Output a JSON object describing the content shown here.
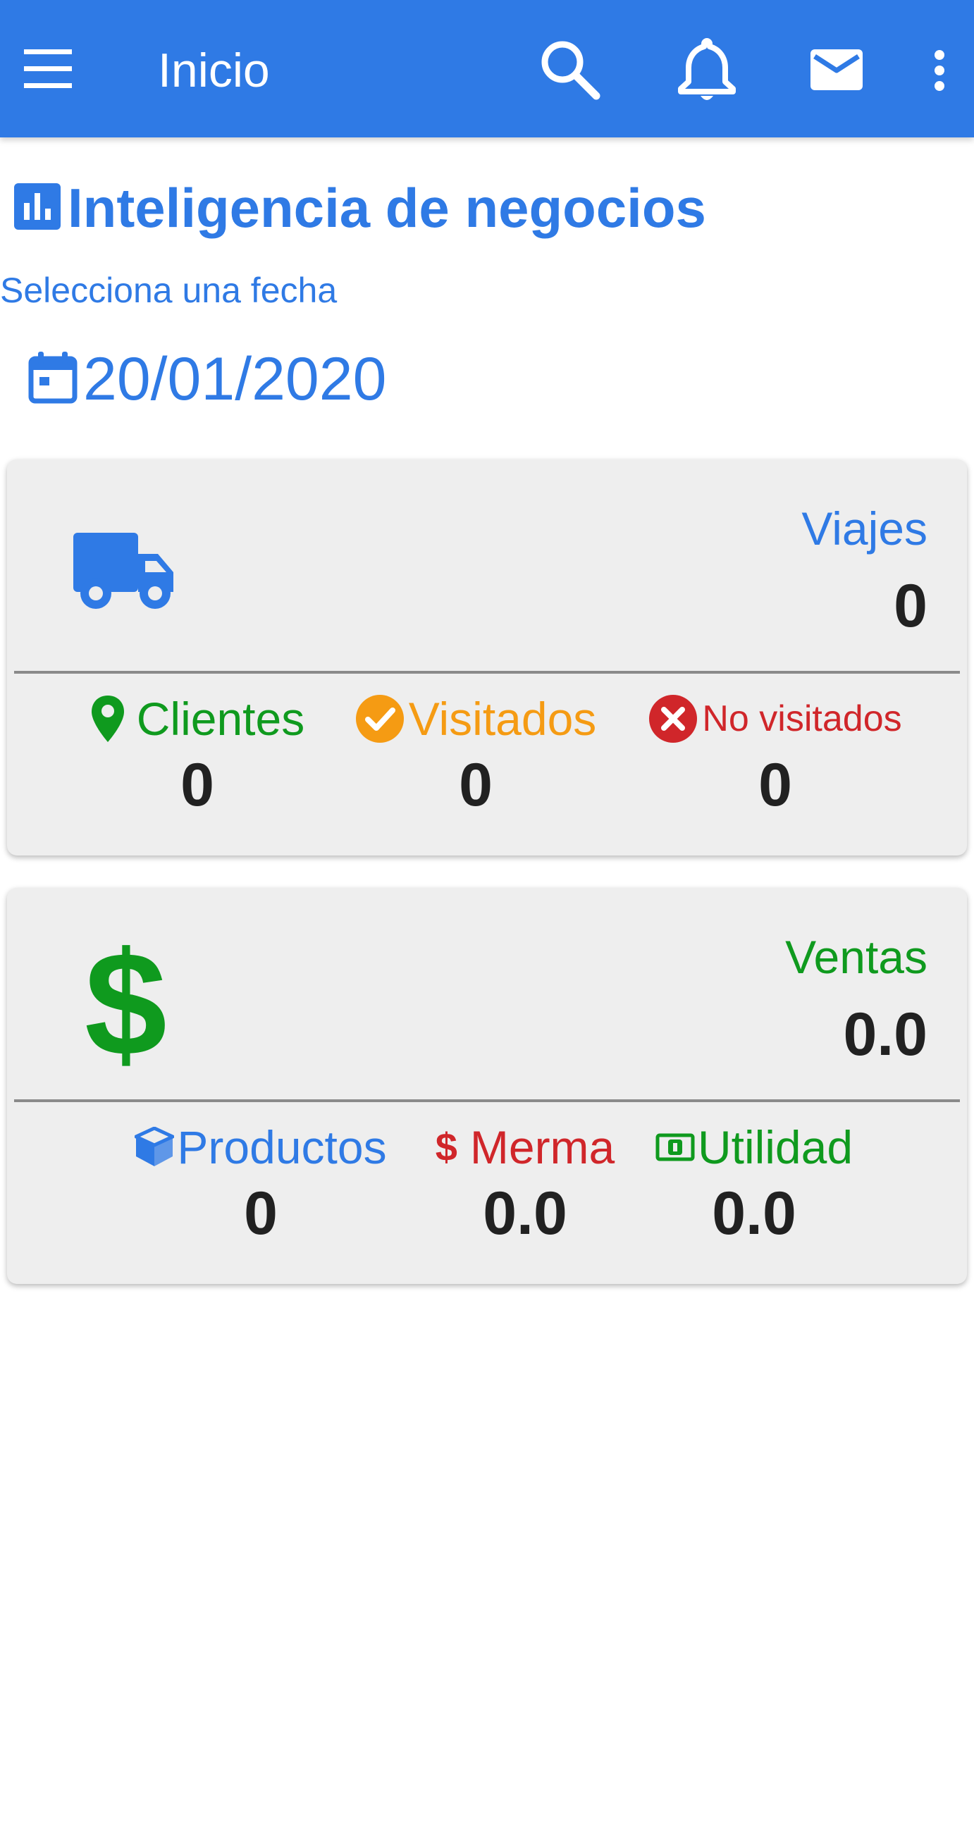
{
  "appbar": {
    "title": "Inicio",
    "icons": [
      "menu-icon",
      "search-icon",
      "bell-icon",
      "mail-icon",
      "more-vert-icon"
    ]
  },
  "section": {
    "icon": "bar-chart-icon",
    "title": "Inteligencia de negocios"
  },
  "date_prompt": "Selecciona una fecha",
  "date": {
    "icon": "calendar-icon",
    "value": "20/01/2020"
  },
  "trips_card": {
    "icon": "truck-icon",
    "label": "Viajes",
    "value": "0",
    "stats": [
      {
        "icon": "location-pin-icon",
        "label": "Clientes",
        "value": "0",
        "color": "#0f9a1e"
      },
      {
        "icon": "check-circle-icon",
        "label": "Visitados",
        "value": "0",
        "color": "#f59b13"
      },
      {
        "icon": "cancel-circle-icon",
        "label": "No visitados",
        "value": "0",
        "color": "#d0262a"
      }
    ]
  },
  "sales_card": {
    "icon": "dollar-icon",
    "label": "Ventas",
    "value": "0.0",
    "stats": [
      {
        "icon": "box-icon",
        "label": "Productos",
        "value": "0",
        "color": "#2f7ae5"
      },
      {
        "icon": "dollar-small-icon",
        "label": "Merma",
        "value": "0.0",
        "color": "#d0262a"
      },
      {
        "icon": "money-icon",
        "label": "Utilidad",
        "value": "0.0",
        "color": "#0f9a1e"
      }
    ]
  },
  "colors": {
    "primary": "#2f7ae5",
    "green": "#0f9a1e",
    "orange": "#f59b13",
    "red": "#d0262a",
    "card_bg": "#eeeeee",
    "value_text": "#212121"
  }
}
